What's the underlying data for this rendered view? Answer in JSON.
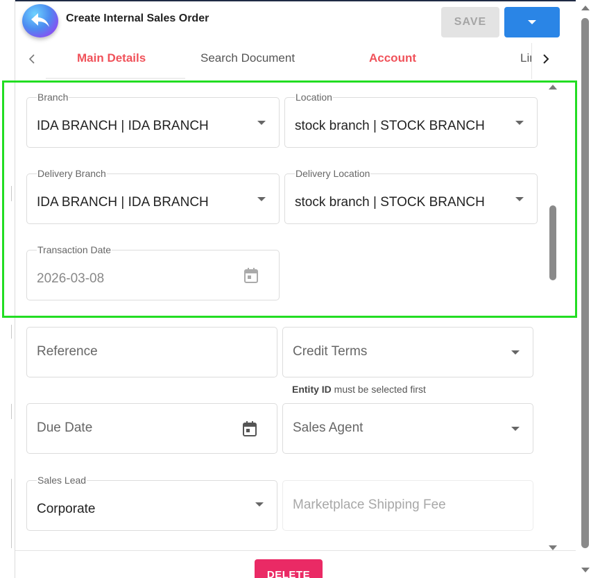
{
  "header": {
    "title": "Create Internal Sales Order",
    "save_label": "SAVE"
  },
  "tabs": [
    {
      "label": "Main Details"
    },
    {
      "label": "Search Document"
    },
    {
      "label": "Account"
    },
    {
      "label": "Lin"
    }
  ],
  "form": {
    "branch": {
      "label": "Branch",
      "value": "IDA BRANCH | IDA BRANCH"
    },
    "location": {
      "label": "Location",
      "value": "stock branch | STOCK BRANCH"
    },
    "delivery_branch": {
      "label": "Delivery Branch",
      "value": "IDA BRANCH | IDA BRANCH"
    },
    "delivery_location": {
      "label": "Delivery Location",
      "value": "stock branch | STOCK BRANCH"
    },
    "transaction_date": {
      "label": "Transaction Date",
      "value": "2026-03-08"
    },
    "reference": {
      "placeholder": "Reference"
    },
    "credit_terms": {
      "placeholder": "Credit Terms"
    },
    "credit_terms_helper": {
      "bold": "Entity ID",
      "text": " must be selected first"
    },
    "due_date": {
      "placeholder": "Due Date"
    },
    "sales_agent": {
      "placeholder": "Sales Agent"
    },
    "sales_lead": {
      "label": "Sales Lead",
      "value": "Corporate"
    },
    "marketplace_shipping_fee": {
      "placeholder": "Marketplace Shipping Fee"
    }
  },
  "footer": {
    "delete_label": "DELETE"
  },
  "colors": {
    "accent_red": "#f0525a",
    "primary_blue": "#2a85e6",
    "delete_pink": "#ea2a65",
    "highlight_green": "#22dd22"
  }
}
